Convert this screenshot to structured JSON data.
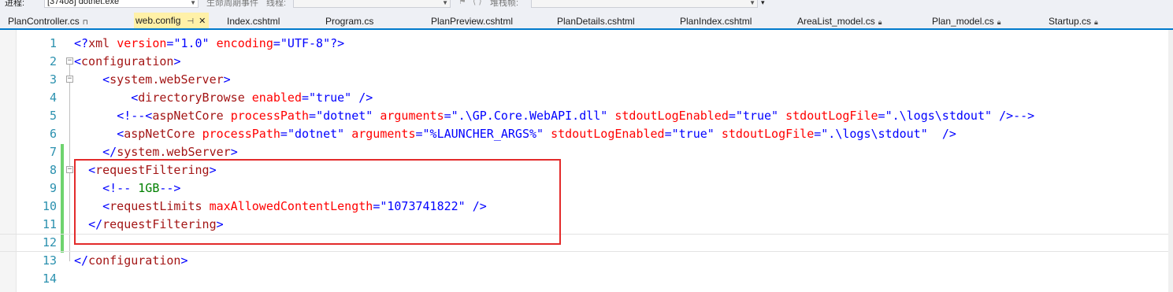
{
  "toolbar": {
    "process_label": "进程:",
    "process_value": "[37408] dotnet.exe",
    "lifecycle_label": "生命周期事件",
    "thread_label": "线程:",
    "stack_label": "堆栈帧:"
  },
  "tabs": [
    {
      "label": "PlanController.cs",
      "pinned": true
    },
    {
      "label": "web.config",
      "active": true
    },
    {
      "label": "Index.cshtml"
    },
    {
      "label": "Program.cs"
    },
    {
      "label": "PlanPreview.cshtml"
    },
    {
      "label": "PlanDetails.cshtml"
    },
    {
      "label": "PlanIndex.cshtml"
    },
    {
      "label": "AreaList_model.cs",
      "locked": true
    },
    {
      "label": "Plan_model.cs",
      "locked": true
    },
    {
      "label": "Startup.cs",
      "locked": true
    }
  ],
  "tab_icons": {
    "pin": "pin-icon",
    "close": "close-icon",
    "lock": "lock-icon"
  },
  "editor": {
    "line_numbers": [
      "1",
      "2",
      "3",
      "4",
      "5",
      "6",
      "7",
      "8",
      "9",
      "10",
      "11",
      "12",
      "13",
      "14"
    ],
    "current_line": "12",
    "lines": [
      "<?xml version=\"1.0\" encoding=\"UTF-8\"?>",
      "<configuration>",
      "    <system.webServer>",
      "        <directoryBrowse enabled=\"true\" />",
      "      <!--<aspNetCore processPath=\"dotnet\" arguments=\".\\GP.Core.WebAPI.dll\" stdoutLogEnabled=\"true\" stdoutLogFile=\".\\logs\\stdout\" />-->",
      "      <aspNetCore processPath=\"dotnet\" arguments=\"%LAUNCHER_ARGS%\" stdoutLogEnabled=\"true\" stdoutLogFile=\".\\logs\\stdout\"  />",
      "    </system.webServer>",
      "  <requestFiltering>",
      "    <!-- 1GB-->",
      "    <requestLimits maxAllowedContentLength=\"1073741822\" />",
      "  </requestFiltering>",
      "",
      "</configuration>",
      ""
    ]
  },
  "colors": {
    "accent": "#007acc",
    "active_tab": "#fff1a8",
    "line_number": "#2b91af",
    "xml_bracket": "#0000ff",
    "xml_tag": "#a31515",
    "xml_attr": "#ff0000",
    "xml_comment": "#008000",
    "change_bar": "#6fd36f",
    "highlight_box": "#e32b2b"
  }
}
